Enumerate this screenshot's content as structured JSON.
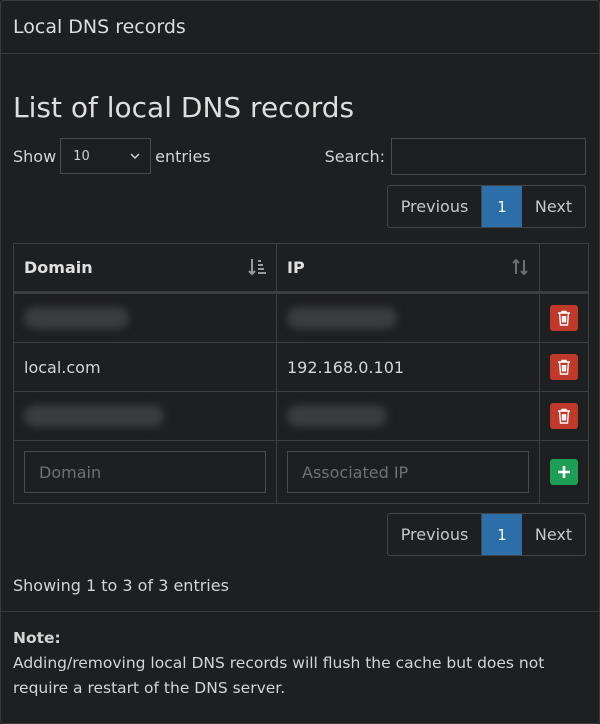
{
  "header": {
    "title": "Local DNS records"
  },
  "main": {
    "heading": "List of local DNS records",
    "length": {
      "show_label": "Show",
      "value": "10",
      "entries_label": "entries"
    },
    "search": {
      "label": "Search:",
      "value": ""
    },
    "pagination": {
      "previous": "Previous",
      "current": "1",
      "next": "Next"
    },
    "table": {
      "columns": [
        "Domain",
        "IP"
      ],
      "rows": [
        {
          "domain": "",
          "ip": "",
          "redacted": true
        },
        {
          "domain": "local.com",
          "ip": "192.168.0.101",
          "redacted": false
        },
        {
          "domain": "",
          "ip": "",
          "redacted": true
        }
      ],
      "new_row": {
        "domain_placeholder": "Domain",
        "ip_placeholder": "Associated IP"
      }
    },
    "info": "Showing 1 to 3 of 3 entries"
  },
  "footer": {
    "note_label": "Note:",
    "note_text": "Adding/removing local DNS records will flush the cache but does not require a restart of the DNS server."
  },
  "colors": {
    "accent": "#2c6fa8",
    "delete": "#c0392b",
    "add": "#1e9d55",
    "background": "#1e1f21"
  }
}
